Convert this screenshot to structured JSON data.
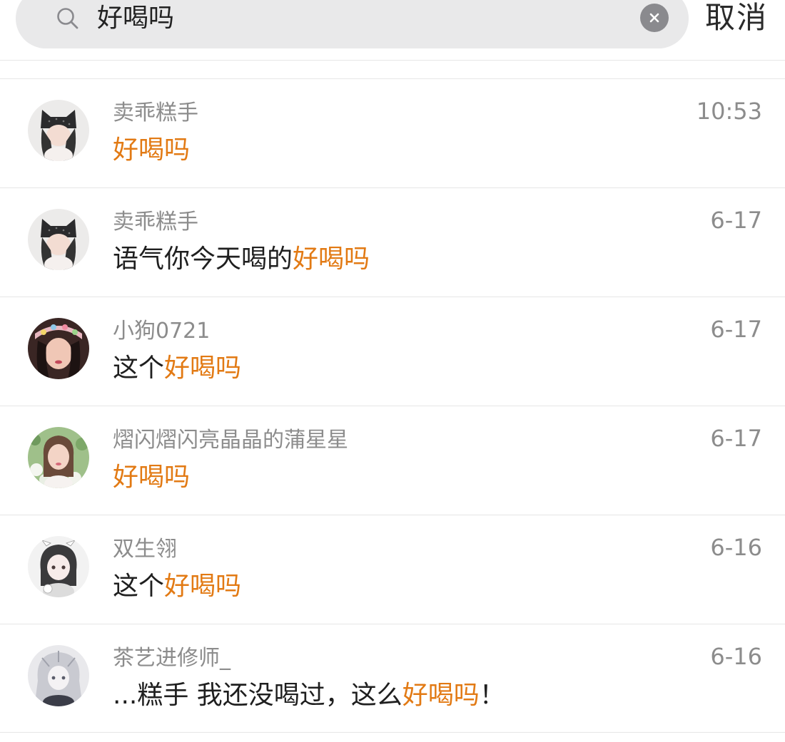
{
  "search": {
    "value": "好喝吗",
    "clear_icon": "close-circle-icon",
    "search_icon": "magnifier-icon",
    "cancel_label": "取消"
  },
  "colors": {
    "highlight": "#e27a14",
    "meta_text": "#8c8c8c",
    "body_text": "#1f1f1f",
    "search_bg": "#e9e9ea"
  },
  "results": [
    {
      "sender": "卖乖糕手",
      "time": "10:53",
      "prefix": "",
      "match": "好喝吗",
      "suffix": "",
      "avatar": "avatar-girl-cat-ear-hat"
    },
    {
      "sender": "卖乖糕手",
      "time": "6-17",
      "prefix": "语气你今天喝的",
      "match": "好喝吗",
      "suffix": "",
      "avatar": "avatar-girl-cat-ear-hat"
    },
    {
      "sender": "小狗0721",
      "time": "6-17",
      "prefix": "这个",
      "match": "好喝吗",
      "suffix": "",
      "avatar": "avatar-girl-flower-crown"
    },
    {
      "sender": "熠闪熠闪亮晶晶的蒲星星",
      "time": "6-17",
      "prefix": "",
      "match": "好喝吗",
      "suffix": "",
      "avatar": "avatar-girl-flowers"
    },
    {
      "sender": "双生翎",
      "time": "6-16",
      "prefix": "这个",
      "match": "好喝吗",
      "suffix": "",
      "avatar": "avatar-anime-girl"
    },
    {
      "sender": "茶艺进修师_",
      "time": "6-16",
      "prefix": "...糕手 我还没喝过，这么",
      "match": "好喝吗",
      "suffix": "！",
      "avatar": "avatar-anime-silver-hair"
    }
  ]
}
